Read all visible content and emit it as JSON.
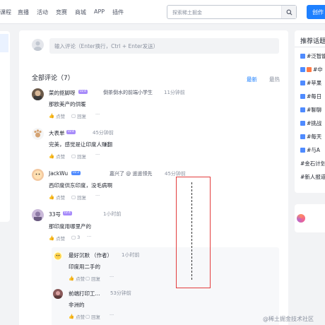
{
  "topbar": {
    "nav": [
      "课程",
      "直播",
      "活动",
      "竞赛",
      "商城",
      "APP",
      "插件"
    ],
    "search_placeholder": "探索稀土掘金",
    "create_label": "创作"
  },
  "composer": {
    "placeholder": "输入评论（Enter换行，Ctrl + Enter发送）"
  },
  "comments_header": {
    "title": "全部评论（7）",
    "sort_new": "最新",
    "sort_hot": "最热"
  },
  "comments": [
    {
      "name": "菜的抠脚呀",
      "level": "LV.4",
      "extra": "倒茶倒水的前端小学生",
      "time": "11分钟前",
      "text": "那欧美产的供暖",
      "reply": "回复",
      "like": "点赞",
      "replies_count": "",
      "more": "···"
    },
    {
      "name": "大表单",
      "level": "LV.4",
      "extra": "",
      "time": "45分钟前",
      "text": "完美，感觉是让印度人赚翻",
      "reply": "回复",
      "like": "点赞",
      "replies_count": "",
      "more": "···"
    },
    {
      "name": "JackWu",
      "level": "LV.3",
      "extra": "嘉兴了 @ 遥遥领先",
      "time": "45分钟前",
      "text": "西印度供东印度，没毛病啊",
      "reply": "回复",
      "like": "点赞",
      "replies_count": "",
      "more": "···"
    },
    {
      "name": "33号",
      "level": "LV.4",
      "extra": "",
      "time": "1小时前",
      "text": "那印度用哪里产的",
      "reply": "",
      "like": "点赞",
      "replies_count": "3",
      "more": "···"
    }
  ],
  "replies": [
    {
      "name": "最好沉默",
      "role": "（作者）",
      "time": "1小时前",
      "text": "印度用二手的",
      "reply": "回复",
      "like": "点赞",
      "more": "···"
    },
    {
      "name": "前端打印工...",
      "time": "53分钟前",
      "text": "非洲的",
      "reply": "回复",
      "like": "点赞",
      "more": "···"
    }
  ],
  "right": {
    "title": "推荐话题",
    "items": [
      "#泛智能",
      "#中",
      "#苹果",
      "#每日",
      "#聊聊",
      "#挑战",
      "#每天",
      "#与A",
      "#金石计划",
      "#新人报道"
    ]
  },
  "watermark": "@稀土掘金技术社区",
  "colors": {
    "accent": "#1e80ff",
    "annotation": "#e33c3c"
  }
}
